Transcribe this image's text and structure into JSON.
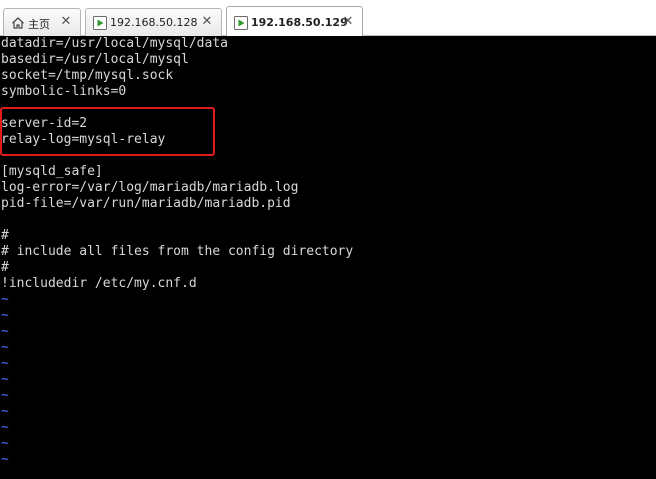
{
  "tabs": [
    {
      "label": "主页",
      "icon": "home-icon",
      "active": false
    },
    {
      "label": "192.168.50.128",
      "icon": "vm-icon",
      "active": false
    },
    {
      "label": "192.168.50.129",
      "icon": "vm-icon",
      "active": true
    }
  ],
  "tab_close_glyph": "✕",
  "terminal": {
    "lines": [
      "datadir=/usr/local/mysql/data",
      "basedir=/usr/local/mysql",
      "socket=/tmp/mysql.sock",
      "symbolic-links=0",
      "",
      "server-id=2",
      "relay-log=mysql-relay",
      "",
      "[mysqld_safe]",
      "log-error=/var/log/mariadb/mariadb.log",
      "pid-file=/var/run/mariadb/mariadb.pid",
      "",
      "#",
      "# include all files from the config directory",
      "#",
      "!includedir /etc/my.cnf.d"
    ],
    "empty_line_marker": "~",
    "empty_line_count": 11,
    "highlighted_lines": [
      "server-id=2",
      "relay-log=mysql-relay"
    ],
    "colors": {
      "background": "#000000",
      "text": "#d8d8d8",
      "tilde": "#4f6bff",
      "highlight_border": "#e01b1b"
    }
  }
}
